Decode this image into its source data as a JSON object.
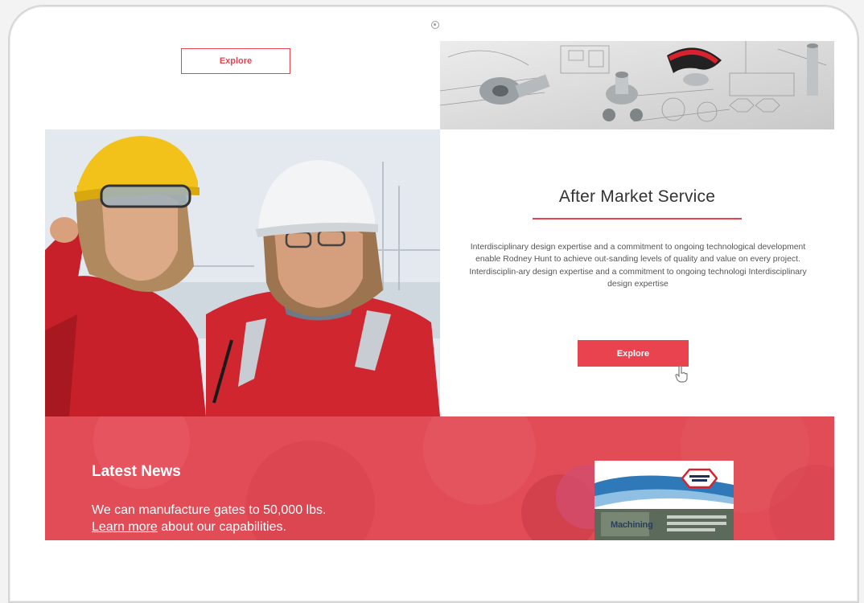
{
  "top_explore": {
    "label": "Explore"
  },
  "service": {
    "title": "After Market Service",
    "body": "Interdisciplinary design expertise  and a commitment to ongoing technological  development  enable Rodney Hunt to achieve out-sanding levels of quality and value on every project. Interdisciplin-ary design expertise  and a commitment to ongoing technologi Interdisciplinary design expertise",
    "explore_label": "Explore"
  },
  "news": {
    "title": "Latest News",
    "line1": "We can manufacture gates to 50,000 lbs.",
    "learn_more": "Learn more",
    "line2_rest": " about our capabilities.",
    "magazine_title": "Machining"
  },
  "colors": {
    "accent": "#e8434f",
    "news_band": "#e14c57"
  },
  "icons": {
    "cursor": "hand-pointer-icon",
    "camera": "camera-icon"
  }
}
